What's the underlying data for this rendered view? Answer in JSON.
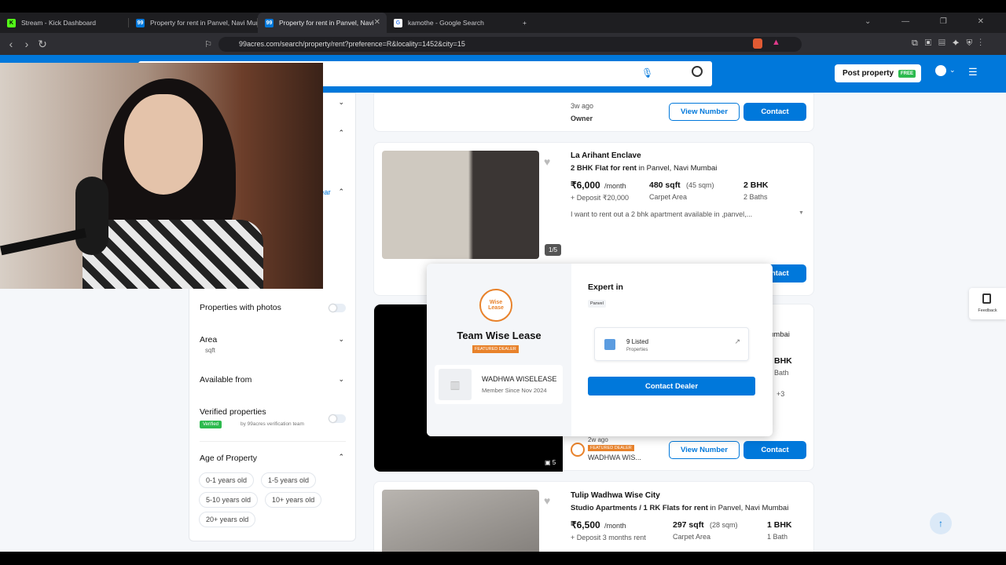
{
  "tabs": [
    {
      "label": "Stream - Kick Dashboard",
      "fav": "K",
      "color": "#53fc18"
    },
    {
      "label": "Property for rent in Panvel, Navi Mum",
      "fav": "99",
      "color": "#0078db"
    },
    {
      "label": "Property for rent in Panvel, Navi",
      "fav": "99",
      "color": "#0078db"
    },
    {
      "label": "kamothe - Google Search",
      "fav": "G",
      "color": "#ffffff"
    }
  ],
  "url": "99acres.com/search/property/rent?preference=R&locality=1452&city=15",
  "header": {
    "post_label": "Post property",
    "free_label": "FREE"
  },
  "filters": {
    "clear": "ear",
    "photos": "Properties with photos",
    "area": "Area",
    "area_unit": "sqft",
    "available": "Available from",
    "verified": "Verified properties",
    "verified_badge": "Verified",
    "verified_note": "by 99acres verification team",
    "age": "Age of Property",
    "ages": [
      "0-1 years old",
      "1-5 years old",
      "5-10 years old",
      "10+ years old",
      "20+ years old"
    ]
  },
  "card0": {
    "posted": "3w ago",
    "by": "Owner",
    "view": "View Number",
    "contact": "Contact"
  },
  "card1": {
    "name": "La Arihant Enclave",
    "type": "2 BHK Flat for rent",
    "loc": "in Panvel, Navi Mumbai",
    "price": "₹6,000",
    "per": "/month",
    "deposit": "+ Deposit ₹20,000",
    "area": "480 sqft",
    "area_alt": "(45 sqm)",
    "area_type": "Carpet Area",
    "bhk": "2 BHK",
    "baths": "2 Baths",
    "desc": "I want to rent out a 2 bhk apartment available in ,panvel,...",
    "photo_count": "1/5",
    "contact": "Contact"
  },
  "card2": {
    "area_right": "umbai",
    "bhk": "BHK",
    "bath": "Bath",
    "more": "+3",
    "posted": "2w ago",
    "dealer_badge": "FEATURED DEALER",
    "dealer_name": "WADHWA WIS...",
    "photos": "5",
    "view": "View Number",
    "contact": "Contact"
  },
  "popup": {
    "logo": "Wise Lease",
    "team": "Team Wise Lease",
    "badge": "FEATURED DEALER",
    "company": "WADHWA WISELEASE",
    "since": "Member Since Nov 2024",
    "expert": "Expert in",
    "locality": "Panvel",
    "listed": "9 Listed",
    "listed_sub": "Properties",
    "button": "Contact Dealer"
  },
  "card3": {
    "name": "Tulip Wadhwa Wise City",
    "type": "Studio Apartments / 1 RK Flats for rent",
    "loc": "in Panvel, Navi Mumbai",
    "price": "₹6,500",
    "per": "/month",
    "deposit": "+ Deposit 3 months rent",
    "area": "297 sqft",
    "area_alt": "(28 sqm)",
    "area_type": "Carpet Area",
    "bhk": "1 BHK",
    "baths": "1 Bath"
  },
  "feedback": "Feedback"
}
